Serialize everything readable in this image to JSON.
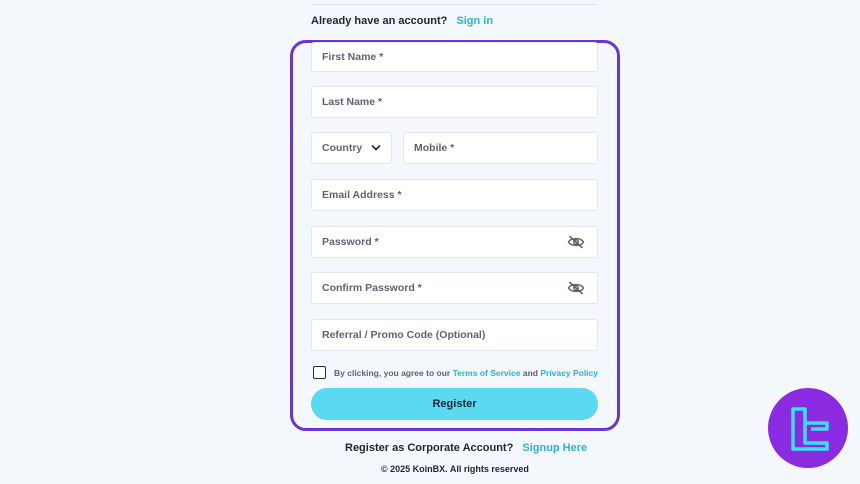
{
  "header": {
    "already_text": "Already have an account?",
    "signin_label": "Sign in"
  },
  "form": {
    "first_name_placeholder": "First Name *",
    "last_name_placeholder": "Last Name *",
    "country_label": "Country",
    "mobile_placeholder": "Mobile *",
    "email_placeholder": "Email Address *",
    "password_placeholder": "Password *",
    "confirm_password_placeholder": "Confirm Password *",
    "referral_placeholder": "Referral / Promo Code (Optional)",
    "terms_prefix": "By clicking, you agree to our",
    "terms_link": "Terms of Service",
    "terms_and": "and",
    "privacy_link": "Privacy Policy",
    "register_label": "Register"
  },
  "footer": {
    "corporate_text": "Register as Corporate Account?",
    "signup_label": "Signup Here",
    "copyright": "© 2025 KoinBX. All rights reserved"
  },
  "colors": {
    "accent": "#2bb4cf",
    "button": "#5ad9f3",
    "highlight": "#6a35d0",
    "watermark": "#8a2be2"
  }
}
